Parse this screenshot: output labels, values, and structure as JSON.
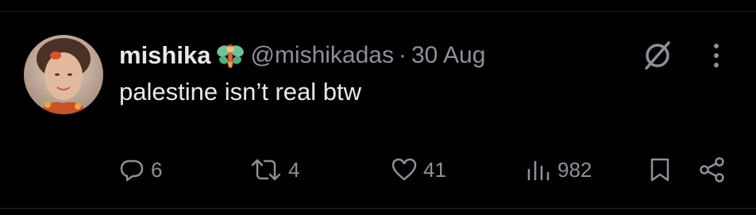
{
  "tweet": {
    "author": {
      "display_name": "mishika",
      "badge_icon": "fairy-emoji-icon",
      "handle": "@mishikadas",
      "separator": "·",
      "date": "30 Aug"
    },
    "text": "palestine isn’t real btw",
    "stats": {
      "replies": "6",
      "retweets": "4",
      "likes": "41",
      "views": "982"
    }
  },
  "icons": {
    "grok": "grok-icon",
    "more": "more-dots-icon",
    "reply": "reply-icon",
    "retweet": "retweet-icon",
    "like": "heart-icon",
    "views": "views-chart-icon",
    "bookmark": "bookmark-icon",
    "share": "share-icon"
  },
  "colors": {
    "background": "#000000",
    "primary_text": "#e7e9ea",
    "secondary_text": "#8b9197"
  }
}
